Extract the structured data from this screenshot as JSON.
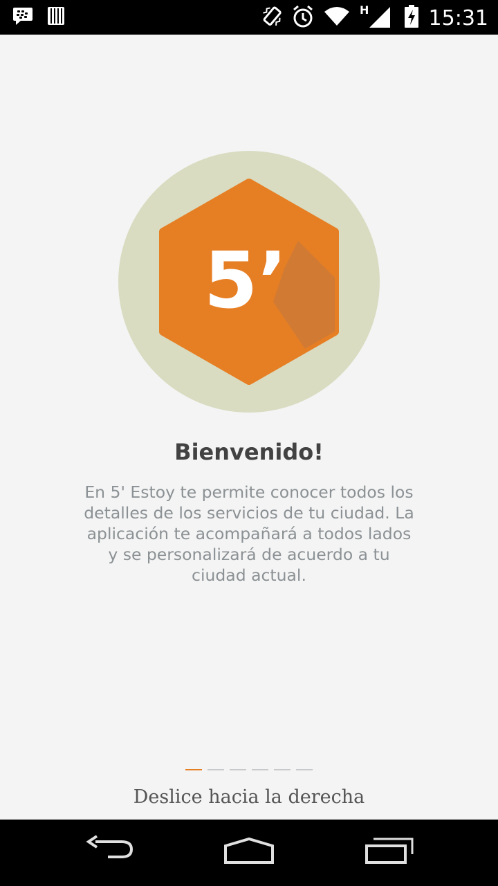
{
  "status_bar": {
    "time": "15:31",
    "network_type": "H",
    "icons": [
      "bbm-icon",
      "barcode-icon",
      "vibrate-icon",
      "alarm-icon",
      "wifi-icon",
      "signal-icon",
      "battery-charging-icon"
    ]
  },
  "logo": {
    "text": "5’",
    "circle_color": "#d9dcc1",
    "hexagon_color": "#e67e23",
    "shadow_color": "#cf7a36"
  },
  "welcome": {
    "title": "Bienvenido!",
    "description": "En 5' Estoy te permite conocer todos los detalles de los servicios de tu ciudad. La aplicación te acompañará a todos lados y se personalizará de acuerdo a tu ciudad actual."
  },
  "pager": {
    "total_pages": 6,
    "current_page": 1,
    "active_color": "#e57f26"
  },
  "swipe_hint": "Deslice hacia la derecha",
  "nav_bar": {
    "buttons": [
      "back-icon",
      "home-icon",
      "recent-apps-icon"
    ]
  }
}
